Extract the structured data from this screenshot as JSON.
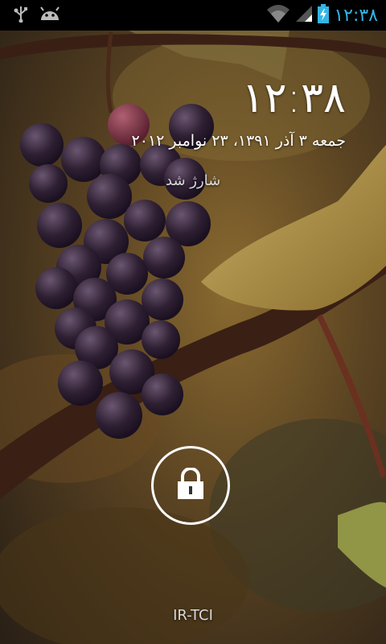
{
  "status_bar": {
    "time": "۱۲:۳۸",
    "icons": [
      "usb-icon",
      "android-debug-icon",
      "wifi-icon",
      "cell-signal-icon",
      "battery-charging-icon"
    ],
    "accent_color": "#33b5e5"
  },
  "lockscreen": {
    "clock": "۱۲:۳۸",
    "date": "جمعه ۳ آذر ۱۳۹۱، ۲۳ نوامبر ۲۰۱۲",
    "charge_status": "شارژ شد",
    "carrier": "IR-TCI",
    "unlock_icon": "lock-icon"
  },
  "wallpaper": {
    "subject": "grape-cluster-on-vine",
    "colors": {
      "sky": "#6b5a2e",
      "branch": "#3a1f12",
      "grape": "#2e1e33",
      "leaf": "#b89a4a"
    }
  }
}
